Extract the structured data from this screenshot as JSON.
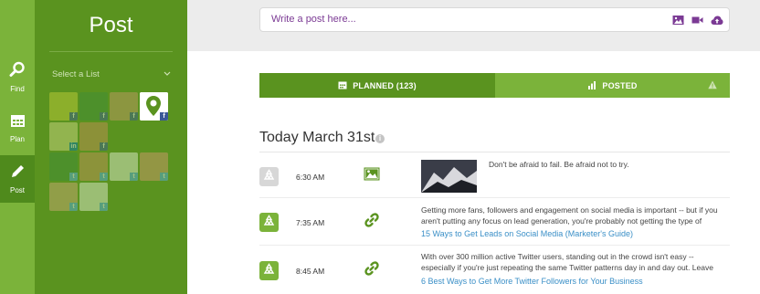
{
  "rail": {
    "find_label": "Find",
    "plan_label": "Plan",
    "post_label": "Post"
  },
  "panel": {
    "title": "Post",
    "select_list": "Select a List"
  },
  "compose": {
    "placeholder": "Write a post here..."
  },
  "tabs": {
    "planned": "PLANNED (123)",
    "posted": "POSTED"
  },
  "day": {
    "title": "Today March 31st",
    "info": "i"
  },
  "posts": [
    {
      "time": "6:30 AM",
      "type": "image",
      "recycle": "off",
      "text": "Don't be afraid to fail. Be afraid not to try."
    },
    {
      "time": "7:35 AM",
      "type": "link",
      "recycle": "on",
      "text": "Getting more fans, followers and engagement on social media is important -- but if you aren't putting any focus on lead generation, you're probably not getting the type of",
      "link": "15 Ways to Get Leads on Social Media (Marketer's Guide)"
    },
    {
      "time": "8:45 AM",
      "type": "link",
      "recycle": "on",
      "text": "With over 300 million active Twitter users, standing out in the crowd isn't easy -- especially if you're just repeating the same Twitter patterns day in and day out. Leave",
      "link": "6 Best Ways to Get More Twitter Followers for Your Business"
    }
  ],
  "colors": {
    "rail": "#7bb33a",
    "panel": "#5a931f",
    "accent_purple": "#7b3a94",
    "link_blue": "#3a8fc7"
  }
}
